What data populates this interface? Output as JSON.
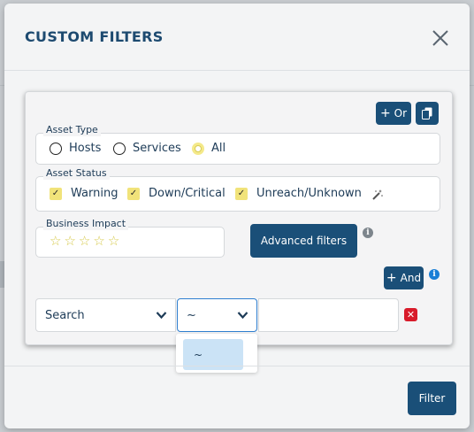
{
  "modal": {
    "title": "CUSTOM FILTERS",
    "close_icon": "close-icon"
  },
  "toolbar": {
    "or_label": "Or",
    "copy_icon": "copy-icon"
  },
  "asset_type": {
    "label": "Asset Type",
    "options": [
      {
        "label": "Hosts",
        "selected": false
      },
      {
        "label": "Services",
        "selected": false
      },
      {
        "label": "All",
        "selected": true
      }
    ]
  },
  "asset_status": {
    "label": "Asset Status",
    "options": [
      {
        "label": "Warning",
        "checked": true
      },
      {
        "label": "Down/Critical",
        "checked": true
      },
      {
        "label": "Unreach/Unknown",
        "checked": true
      }
    ],
    "magic_icon": "magic-wand-icon"
  },
  "business_impact": {
    "label": "Business Impact",
    "rating": 0,
    "max": 5
  },
  "advanced_filters_label": "Advanced filters",
  "and_label": "And",
  "condition": {
    "field": "Search",
    "operator": "~",
    "value": ""
  },
  "operator_dropdown": {
    "options": [
      "~"
    ]
  },
  "filter_label": "Filter",
  "colors": {
    "primary": "#1a4f78",
    "accent_yellow": "#f1e37a",
    "delete_red": "#d81b2a",
    "info_blue": "#1a7fd6"
  }
}
